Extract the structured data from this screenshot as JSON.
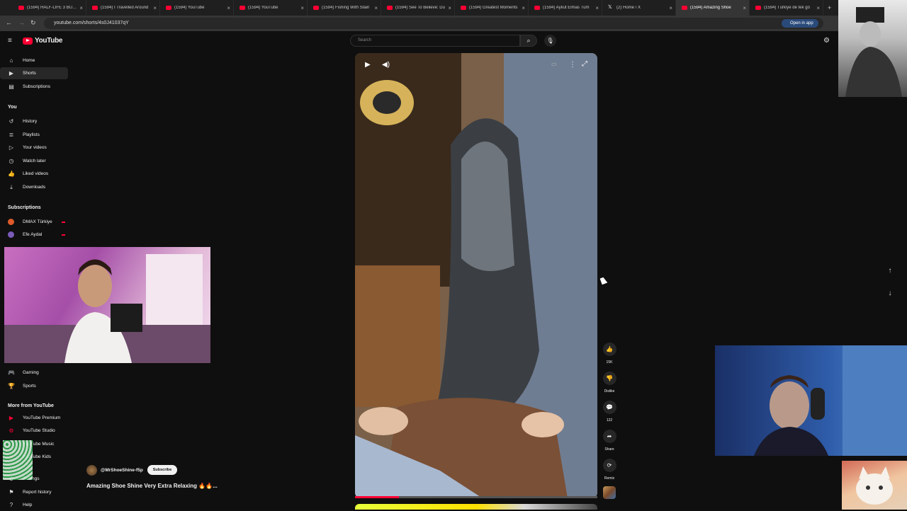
{
  "browser": {
    "tabs": [
      {
        "title": "(1594) HALF-LIFE 3 BU CI",
        "favicon": "youtube-icon"
      },
      {
        "title": "(1594) I Travelled Around",
        "favicon": "youtube-icon"
      },
      {
        "title": "(1594) YouTube",
        "favicon": "youtube-icon"
      },
      {
        "title": "(1594) YouTube",
        "favicon": "youtube-icon"
      },
      {
        "title": "(1594) Fishing With Stain",
        "favicon": "youtube-icon"
      },
      {
        "title": "(1594) See To Believe: Du",
        "favicon": "youtube-icon"
      },
      {
        "title": "(1594) Greatest Moments",
        "favicon": "youtube-icon"
      },
      {
        "title": "(1594) Aykut Elmas Tüm",
        "favicon": "youtube-icon"
      },
      {
        "title": "(2) Home / X",
        "favicon": "x-icon"
      },
      {
        "title": "(1594) Amazing Shoe",
        "favicon": "youtube-icon",
        "active": true
      },
      {
        "title": "(1594) Türkiye de tek gö",
        "favicon": "youtube-icon"
      }
    ],
    "url": "youtube.com/shorts/4s0J41037qY",
    "open_in_app": "Open in app"
  },
  "header": {
    "logo_text": "YouTube",
    "search_placeholder": "Search"
  },
  "sidebar": {
    "main": [
      {
        "label": "Home",
        "icon": "home-icon"
      },
      {
        "label": "Shorts",
        "icon": "shorts-icon",
        "active": true
      },
      {
        "label": "Subscriptions",
        "icon": "subscriptions-icon"
      }
    ],
    "you_heading": "You",
    "you_items": [
      {
        "label": "History",
        "icon": "history-icon"
      },
      {
        "label": "Playlists",
        "icon": "playlists-icon"
      },
      {
        "label": "Your videos",
        "icon": "your-videos-icon"
      },
      {
        "label": "Watch later",
        "icon": "clock-icon"
      },
      {
        "label": "Liked videos",
        "icon": "thumb-up-icon"
      },
      {
        "label": "Downloads",
        "icon": "download-icon"
      }
    ],
    "subs_heading": "Subscriptions",
    "subs": [
      {
        "label": "DMAX Türkiye",
        "color": "#e05a2b"
      },
      {
        "label": "Efe Aydal",
        "color": "#7a5ab8"
      }
    ],
    "explore": [
      {
        "label": "Gaming",
        "icon": "gaming-icon"
      },
      {
        "label": "Sports",
        "icon": "trophy-icon"
      }
    ],
    "more_heading": "More from YouTube",
    "more": [
      {
        "label": "YouTube Premium",
        "icon": "yt-premium-icon"
      },
      {
        "label": "YouTube Studio",
        "icon": "yt-studio-icon"
      },
      {
        "label": "YouTube Music",
        "icon": "yt-music-icon"
      },
      {
        "label": "YouTube Kids",
        "icon": "yt-kids-icon"
      }
    ],
    "footer": [
      {
        "label": "Settings",
        "icon": "gear-icon"
      },
      {
        "label": "Report history",
        "icon": "flag-icon"
      },
      {
        "label": "Help",
        "icon": "help-icon"
      }
    ]
  },
  "video": {
    "channel": "@MrShoeShine-f5p",
    "subscribe_label": "Subscribe",
    "title": "Amazing Shoe Shine Very Extra Relaxing 🔥🔥...",
    "progress": 0.18
  },
  "actions": {
    "likes": "15K",
    "dislike": "Dislike",
    "comments": "122",
    "share": "Share",
    "remix": "Remix"
  }
}
